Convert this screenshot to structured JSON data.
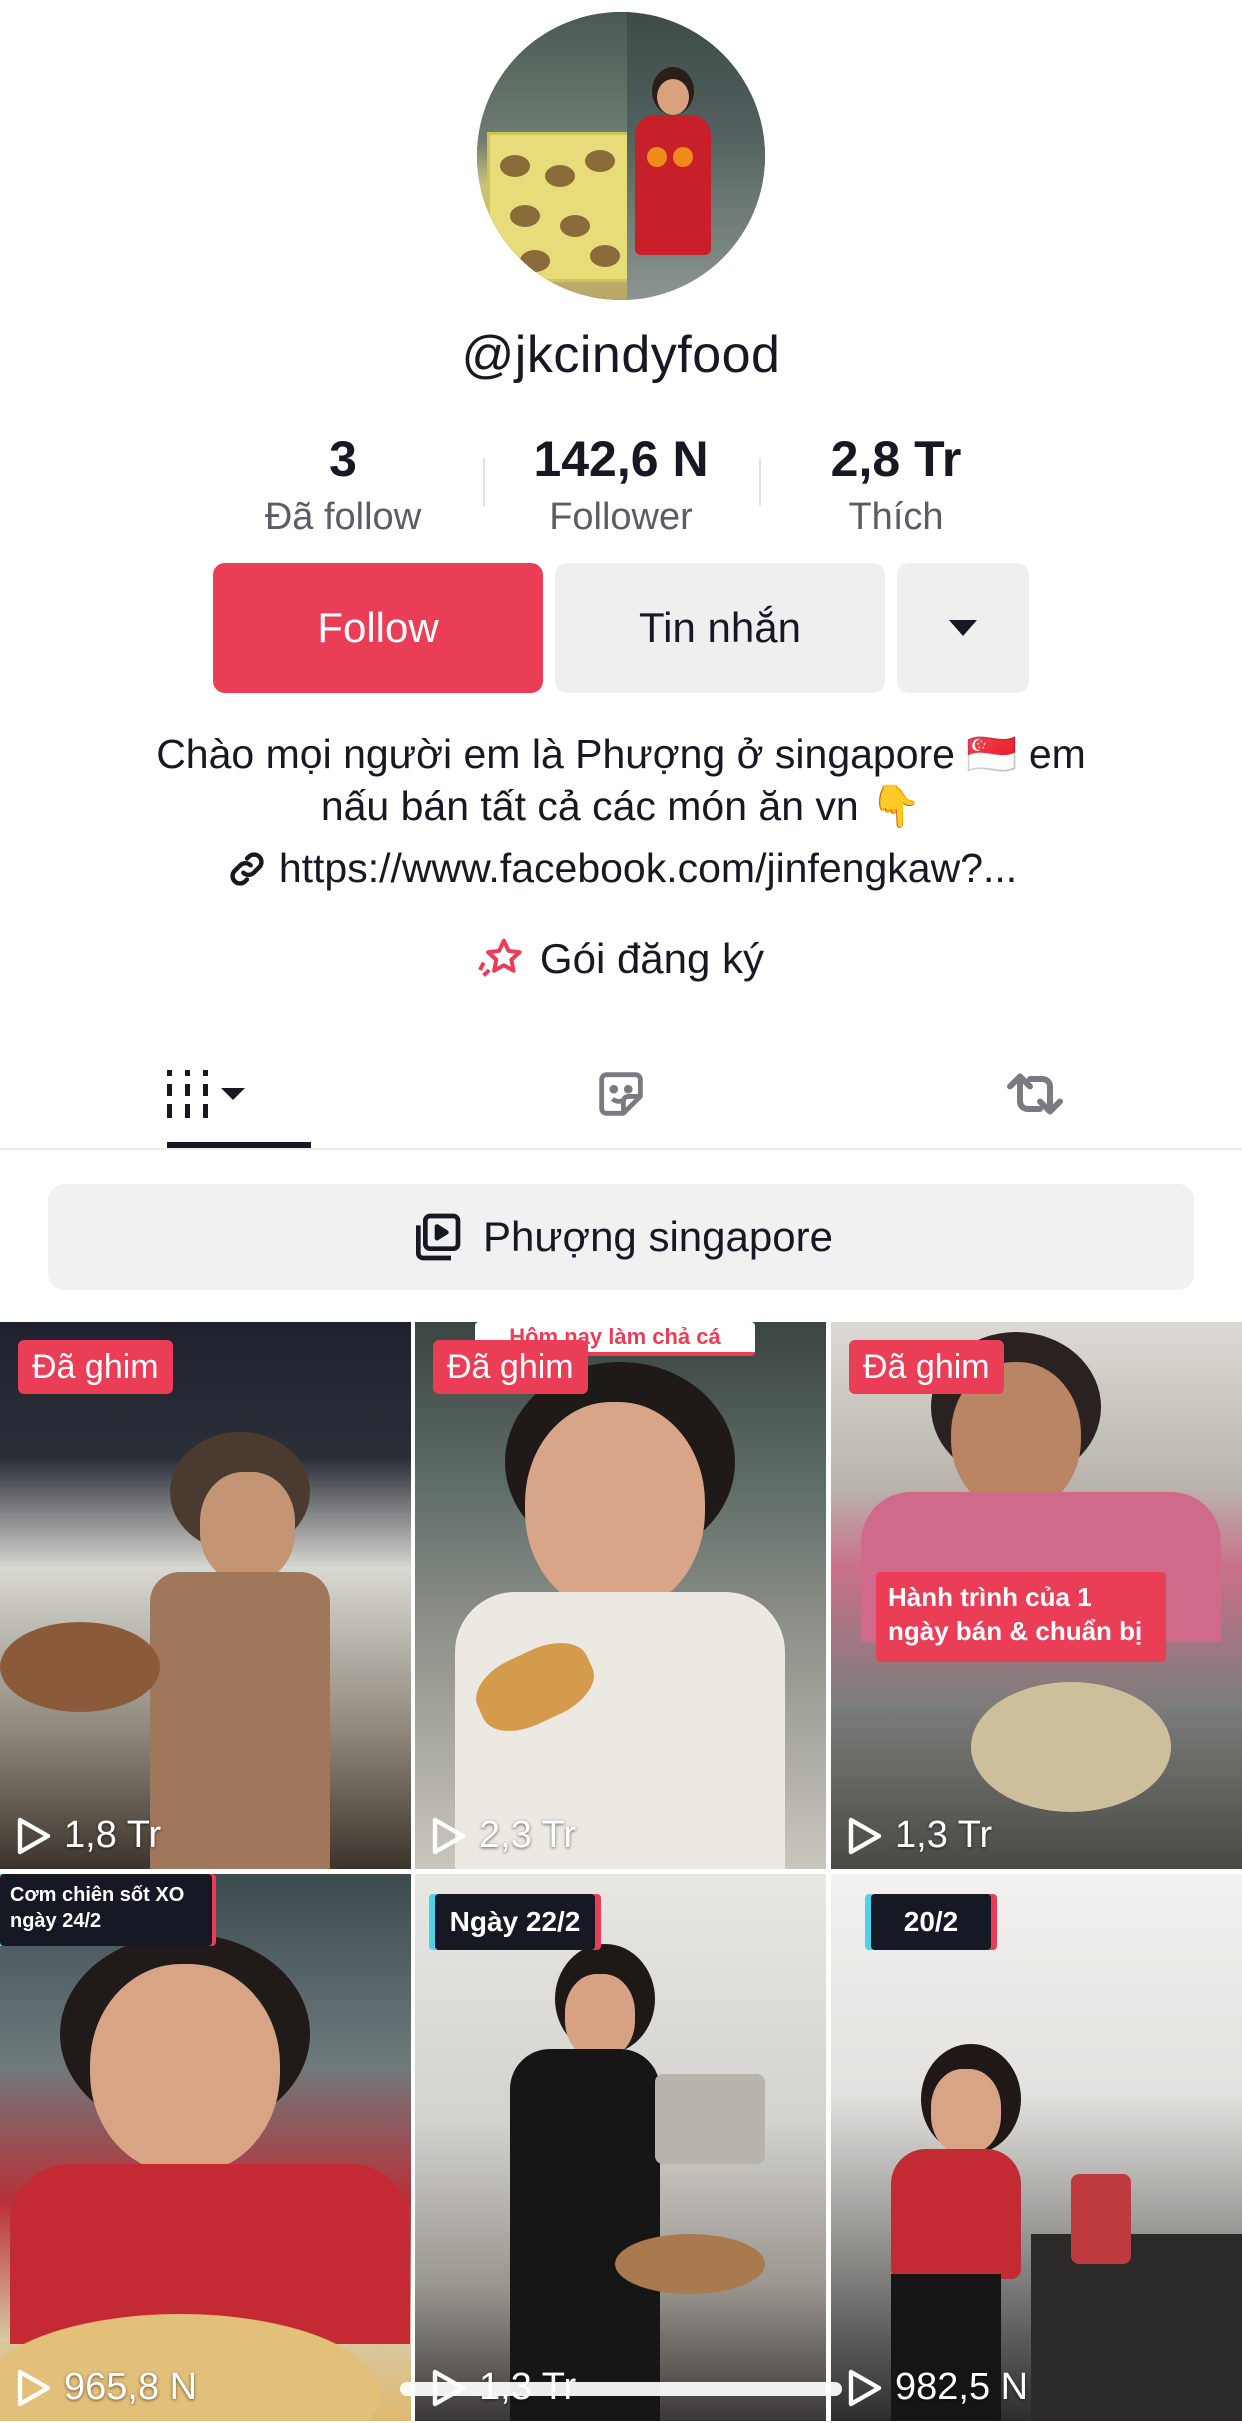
{
  "profile": {
    "username": "@jkcindyfood",
    "stats": [
      {
        "value": "3",
        "label": "Đã follow"
      },
      {
        "value": "142,6 N",
        "label": "Follower"
      },
      {
        "value": "2,8 Tr",
        "label": "Thích"
      }
    ],
    "follow_label": "Follow",
    "message_label": "Tin nhắn",
    "bio_line1": "Chào mọi người em là Phượng ở singapore 🇸🇬 em",
    "bio_line2": "nấu bán tất cả các món ăn vn 👇",
    "link": "https://www.facebook.com/jinfengkaw?...",
    "subscription_label": "Gói đăng ký"
  },
  "tabs": [
    {
      "icon": "grid-icon"
    },
    {
      "icon": "sticker-icon"
    },
    {
      "icon": "repost-icon"
    }
  ],
  "playlist_label": "Phượng singapore",
  "videos": [
    {
      "pinned": "Đã ghim",
      "views": "1,8 Tr",
      "caption": ""
    },
    {
      "pinned": "Đã ghim",
      "views": "2,3 Tr",
      "caption": "Hôm nay làm chả cá"
    },
    {
      "pinned": "Đã ghim",
      "views": "1,3 Tr",
      "caption": "Hành trình của 1 ngày bán & chuẩn bị"
    },
    {
      "pinned": "",
      "views": "965,8 N",
      "caption": "Cơm chiên sốt XO ngày 24/2"
    },
    {
      "pinned": "",
      "views": "1,3 Tr",
      "caption": "Ngày 22/2"
    },
    {
      "pinned": "",
      "views": "982,5 N",
      "caption": "20/2"
    }
  ],
  "colors": {
    "accent": "#ea3e57",
    "button_gray": "#efefef",
    "text": "#161823",
    "muted": "#5b5d66"
  }
}
